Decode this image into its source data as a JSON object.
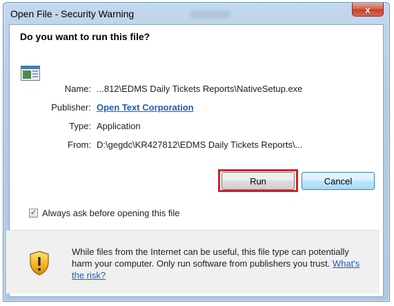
{
  "window": {
    "title": "Open File - Security Warning",
    "close_label": "x"
  },
  "dialog": {
    "question": "Do you want to run this file?",
    "fields": {
      "name_label": "Name:",
      "name_value": "...812\\EDMS Daily Tickets Reports\\NativeSetup.exe",
      "publisher_label": "Publisher:",
      "publisher_value": "Open Text Corporation",
      "type_label": "Type:",
      "type_value": "Application",
      "from_label": "From:",
      "from_value": "D:\\gegdc\\KR427812\\EDMS Daily Tickets Reports\\..."
    },
    "buttons": {
      "run_label": "Run",
      "cancel_label": "Cancel"
    },
    "checkbox": {
      "label": "Always ask before opening this file",
      "checked": true
    },
    "warning": {
      "text": "While files from the Internet can be useful, this file type can potentially harm your computer. Only run software from publishers you trust.",
      "link_label": "What's the risk?"
    }
  },
  "colors": {
    "highlight": "#d3202c",
    "link": "#1a5fb4"
  }
}
